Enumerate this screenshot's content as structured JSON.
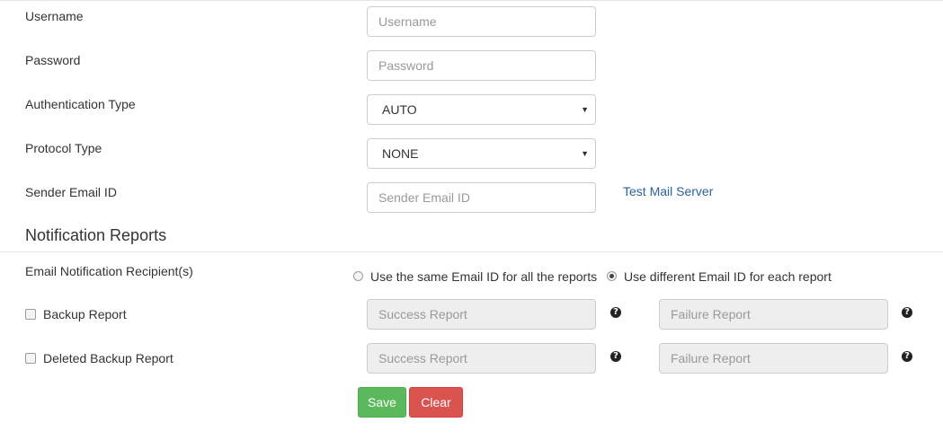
{
  "form": {
    "username": {
      "label": "Username",
      "placeholder": "Username",
      "value": ""
    },
    "password": {
      "label": "Password",
      "placeholder": "Password",
      "value": ""
    },
    "auth_type": {
      "label": "Authentication Type",
      "selected": "AUTO"
    },
    "protocol_type": {
      "label": "Protocol Type",
      "selected": "NONE"
    },
    "sender_email": {
      "label": "Sender Email ID",
      "placeholder": "Sender Email ID",
      "value": ""
    },
    "test_mail_link": "Test Mail Server"
  },
  "notification": {
    "title": "Notification Reports",
    "recipients_label": "Email Notification Recipient(s)",
    "radio_same": "Use the same Email ID for all the reports",
    "radio_different": "Use different Email ID for each report",
    "selected_option": "different",
    "reports": [
      {
        "label": "Backup Report",
        "success_placeholder": "Success Report",
        "failure_placeholder": "Failure Report",
        "checked": false
      },
      {
        "label": "Deleted Backup Report",
        "success_placeholder": "Success Report",
        "failure_placeholder": "Failure Report",
        "checked": false
      }
    ]
  },
  "actions": {
    "save": "Save",
    "clear": "Clear"
  },
  "icons": {
    "help": "question-circle-icon",
    "caret": "caret-down-icon"
  },
  "colors": {
    "save": "#5cb85c",
    "clear": "#d9534f",
    "link": "#2a6496"
  }
}
